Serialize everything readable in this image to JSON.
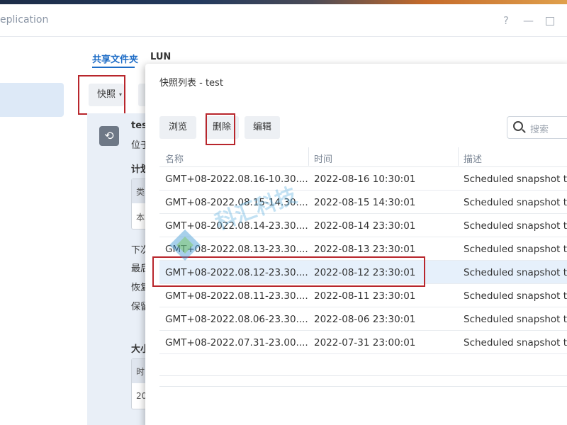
{
  "window": {
    "title": "eplication",
    "help_icon": "?",
    "minimize_icon": "—",
    "maximize_icon": "maximize-icon"
  },
  "tabs": [
    {
      "label": "共享文件夹",
      "active": true
    },
    {
      "label": "LUN",
      "active": false
    }
  ],
  "toolbar": {
    "snapshot_label": "快照",
    "snapshot_caret": "▾"
  },
  "detail": {
    "name": "tes",
    "location": "位于",
    "schedule": "计划",
    "table_head": "类",
    "table_cell": "本",
    "next": "下次",
    "last": "最后",
    "restore": "恢复",
    "retain": "保留",
    "size": "大小",
    "size_table_head": "时",
    "size_table_cell": "20"
  },
  "dialog": {
    "title": "快照列表 - test",
    "buttons": {
      "browse": "浏览",
      "delete": "删除",
      "edit": "编辑"
    },
    "search": {
      "placeholder": "搜索"
    },
    "columns": {
      "name": "名称",
      "time": "时间",
      "description": "描述"
    },
    "rows": [
      {
        "name": "GMT+08-2022.08.16-10.30....",
        "time": "2022-08-16 10:30:01",
        "description": "Scheduled snapshot ta",
        "selected": false
      },
      {
        "name": "GMT+08-2022.08.15-14.30....",
        "time": "2022-08-15 14:30:01",
        "description": "Scheduled snapshot ta",
        "selected": false
      },
      {
        "name": "GMT+08-2022.08.14-23.30....",
        "time": "2022-08-14 23:30:01",
        "description": "Scheduled snapshot ta",
        "selected": false
      },
      {
        "name": "GMT+08-2022.08.13-23.30....",
        "time": "2022-08-13 23:30:01",
        "description": "Scheduled snapshot ta",
        "selected": false
      },
      {
        "name": "GMT+08-2022.08.12-23.30....",
        "time": "2022-08-12 23:30:01",
        "description": "Scheduled snapshot ta",
        "selected": true
      },
      {
        "name": "GMT+08-2022.08.11-23.30....",
        "time": "2022-08-11 23:30:01",
        "description": "Scheduled snapshot ta",
        "selected": false
      },
      {
        "name": "GMT+08-2022.08.06-23.30....",
        "time": "2022-08-06 23:30:01",
        "description": "Scheduled snapshot ta",
        "selected": false
      },
      {
        "name": "GMT+08-2022.07.31-23.00....",
        "time": "2022-07-31 23:00:01",
        "description": "Scheduled snapshot ta",
        "selected": false
      }
    ]
  },
  "watermark": {
    "text": "科汇科技"
  },
  "colors": {
    "accent": "#1d6cc6",
    "highlight_box": "#b8262c",
    "selected_row": "#e6f0fb"
  }
}
